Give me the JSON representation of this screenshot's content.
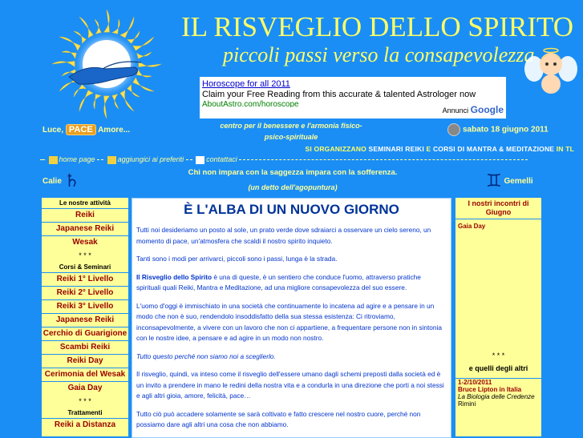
{
  "header": {
    "title": "IL RISVEGLIO DELLO SPIRITO",
    "subtitle": "piccoli passi verso la consapevolezza"
  },
  "ad": {
    "title": "Horoscope for all 2011",
    "text": "Claim your Free Reading from this accurate & talented Astrologer now",
    "url": "AboutAstro.com/horoscope",
    "credit_prefix": "Annunci",
    "credit_brand": "Google"
  },
  "tagline": {
    "before": "Luce,",
    "badge": "PACE",
    "after": "Amore..."
  },
  "center_description": "centro per il benessere e l'armonia fisico-psico-spirituale",
  "date": "sabato 18 giugno 2011",
  "org_line": {
    "p1": "SI ORGANIZZANO",
    "p2": "SEMINARI REIKI",
    "p3": "E",
    "p4": "CORSI DI MANTRA & MEDITAZIONE",
    "p5": "IN TL"
  },
  "nav": {
    "home": "home page",
    "favorites": "aggiungici ai preferiti",
    "contacts": "contattaci"
  },
  "sign_left": {
    "label": "Calie",
    "glyph": "♄"
  },
  "sign_right": {
    "label": "Gemelli",
    "glyph": "♊"
  },
  "quote": "Chi non impara con la saggezza impara con la sofferenza.",
  "quote_source": "(un detto dell'agopuntura)",
  "left_col": {
    "head1": "Le nostre attività",
    "group1": [
      "Reiki",
      "Japanese Reiki",
      "Wesak"
    ],
    "sep": "* * *",
    "head2": "Corsi & Seminari",
    "group2": [
      "Reiki 1° Livello",
      "Reiki 2° Livello",
      "Reiki 3° Livello",
      "Japanese Reiki",
      "Cerchio di Guarigione",
      "Scambi Reiki",
      "Reiki Day",
      "Cerimonia del Wesak",
      "Gaia Day"
    ],
    "head3": "Trattamenti",
    "group3": [
      "Reiki a Distanza"
    ]
  },
  "main": {
    "title": "È L'ALBA DI UN NUOVO GIORNO",
    "p1": "Tutti noi desideriamo un posto al sole, un prato verde dove sdraiarci a osservare un cielo sereno, un momento di pace, un'atmosfera che scaldi il nostro spirito inquieto.",
    "p2": "Tanti sono i modi per arrivarci, piccoli sono i passi, lunga è la strada.",
    "p3_bold": "Il Risveglio dello Spirito",
    "p3_rest": " è una di queste, è un sentiero che conduce l'uomo, attraverso pratiche spirituali quali Reiki, Mantra e Meditazione, ad una migliore consapevolezza del suo essere.",
    "p4": "L'uomo d'oggi è immischiato in una società che continuamente lo incatena ad agire e a pensare in un modo che non è suo, rendendolo insoddisfatto della sua stessa esistenza: Ci ritroviamo, inconsapevolmente, a vivere con un lavoro che non ci appartiene, a frequentare persone non in sintonia con le nostre idee, a pensare e ad agire in un modo non nostro.",
    "p5": "Tutto questo perché non siamo noi a sceglierlo.",
    "p6": "Il risveglio, quindi, va inteso come il risveglio dell'essere umano dagli schemi preposti dalla società ed è un invito a prendere in mano le redini della nostra vita e a condurla in una direzione che porti a noi stessi e agli altri gioia, amore, felicità, pace…",
    "p7": "Tutto ciò può accadere solamente se sarà coltivato e fatto crescere nel nostro cuore, perché non possiamo dare agli altri una cosa che non abbiamo."
  },
  "right_col": {
    "head1": "I nostri incontri di Giugno",
    "item1": "Gaia Day",
    "sep": "* * *",
    "head2": "e quelli degli altri",
    "event_date": "1-2/10/2011",
    "event_name": "Bruce Lipton in Italia",
    "event_sub": "La Biologia delle Credenze",
    "event_loc": "Rimini"
  }
}
